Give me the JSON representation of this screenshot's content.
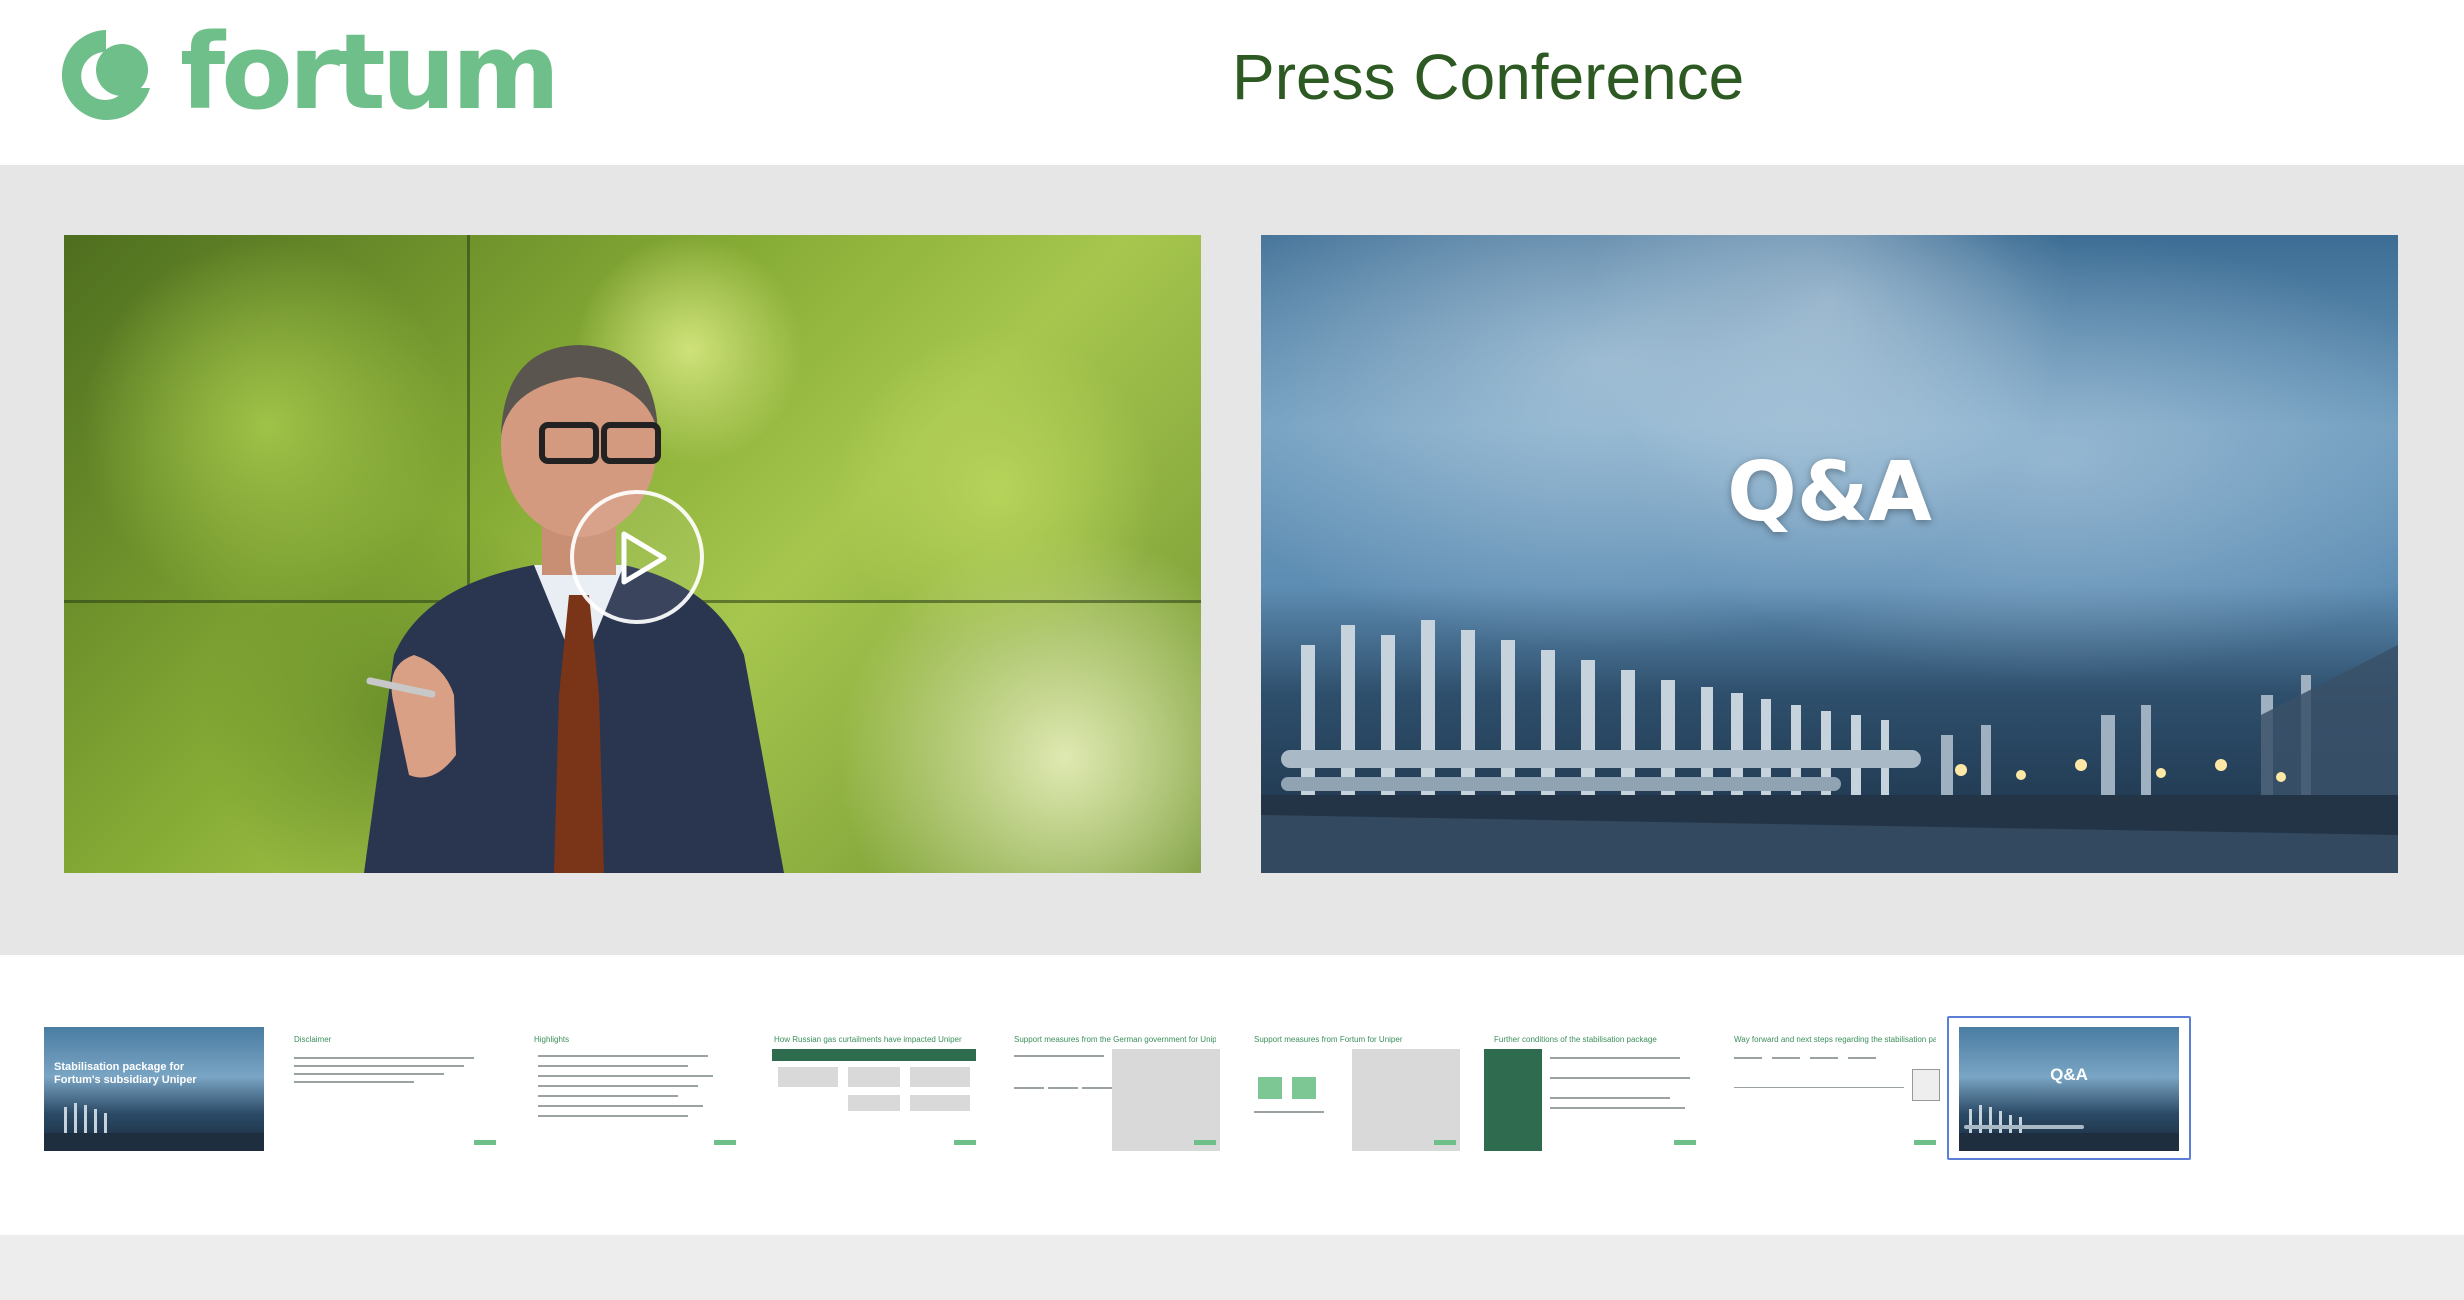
{
  "header": {
    "logo_text": "fortum",
    "title": "Press Conference"
  },
  "main": {
    "video": {
      "play_label": "Play"
    },
    "slide": {
      "title": "Q&A"
    }
  },
  "thumbnails": [
    {
      "title": "Stabilisation package for Fortum's subsidiary Uniper"
    },
    {
      "title": "Disclaimer"
    },
    {
      "title": "Highlights"
    },
    {
      "title": "How Russian gas curtailments have impacted Uniper"
    },
    {
      "title": "Support measures from the German government for Uniper"
    },
    {
      "title": "Support measures from Fortum for Uniper"
    },
    {
      "title": "Further conditions of the stabilisation package"
    },
    {
      "title": "Way forward and next steps regarding the stabilisation package"
    },
    {
      "title": "Q&A"
    }
  ],
  "selected_thumbnail": 9,
  "colors": {
    "brand_green": "#6fbf8a",
    "title_green": "#2d5a22",
    "selection_blue": "#5b7fd6"
  }
}
